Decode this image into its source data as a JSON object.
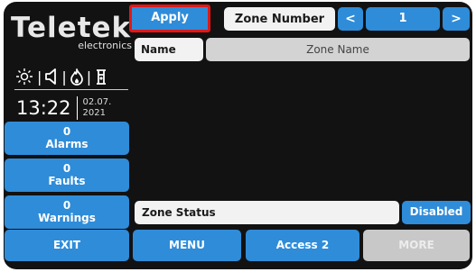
{
  "brand": {
    "name": "Teletek",
    "subtitle": "electronics"
  },
  "status_icons": [
    "sun-icon",
    "speaker-icon",
    "flame-icon",
    "fire-hydrant-icon"
  ],
  "clock": {
    "time": "13:22",
    "date_line1": "02.07.",
    "date_line2": "2021"
  },
  "counters": {
    "alarms": {
      "count": "0",
      "label": "Alarms"
    },
    "faults": {
      "count": "0",
      "label": "Faults"
    },
    "warnings": {
      "count": "0",
      "label": "Warnings"
    }
  },
  "toolbar": {
    "apply_label": "Apply",
    "zone_number_label": "Zone Number",
    "prev_label": "<",
    "zone_number_value": "1",
    "next_label": ">"
  },
  "name_row": {
    "label": "Name",
    "value": "Zone Name"
  },
  "zone_status": {
    "label": "Zone Status",
    "value": "Disabled"
  },
  "bottom_nav": {
    "exit": "EXIT",
    "menu": "MENU",
    "access": "Access 2",
    "more": "MORE"
  },
  "colors": {
    "accent": "#2f8cd9",
    "background": "#121212",
    "highlight": "#e01818",
    "disabled": "#c8c8c8"
  }
}
